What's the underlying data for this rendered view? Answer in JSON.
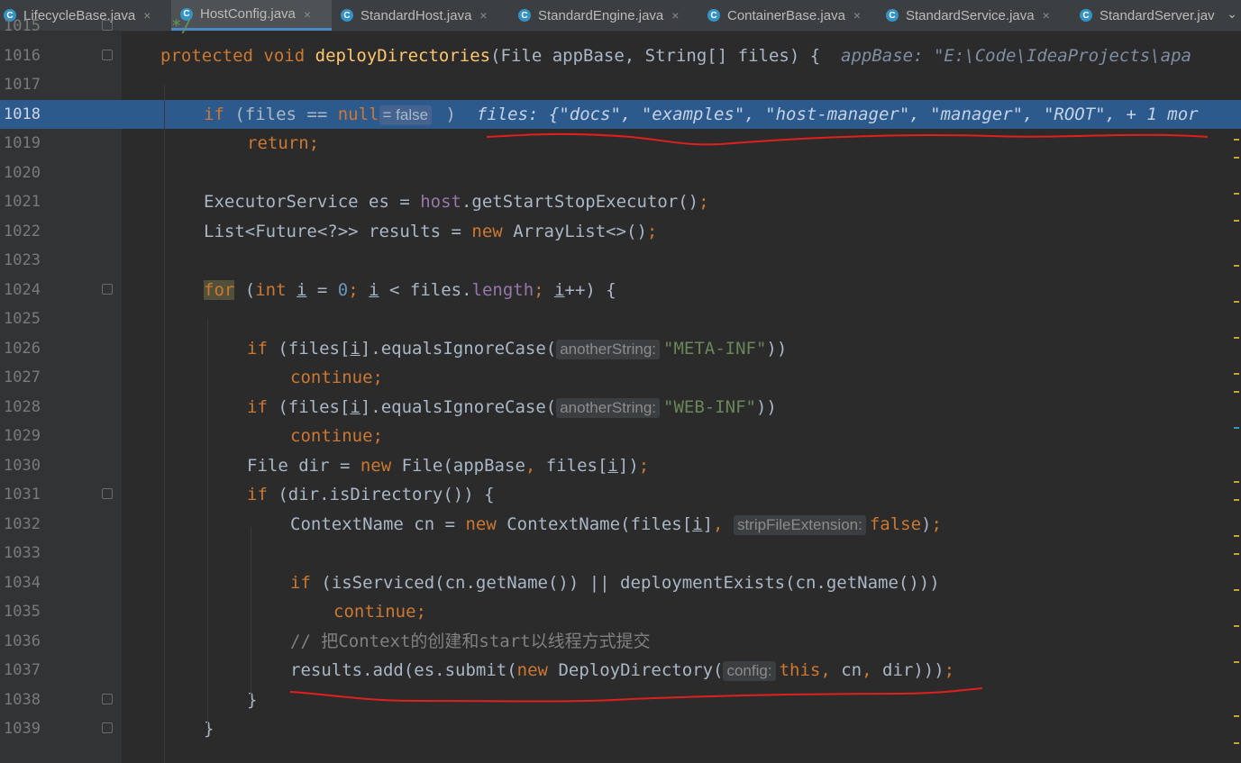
{
  "tabs": [
    {
      "label": "LifecycleBase.java",
      "active": false
    },
    {
      "label": "HostConfig.java",
      "active": true
    },
    {
      "label": "StandardHost.java",
      "active": false
    },
    {
      "label": "StandardEngine.java",
      "active": false
    },
    {
      "label": "ContainerBase.java",
      "active": false
    },
    {
      "label": "StandardService.java",
      "active": false
    },
    {
      "label": "StandardServer.jav",
      "active": false
    }
  ],
  "class_icon_letter": "C",
  "close_glyph": "×",
  "more_glyph": "⌄",
  "line_numbers": [
    "1015",
    "1016",
    "1017",
    "1018",
    "1019",
    "1020",
    "1021",
    "1022",
    "1023",
    "1024",
    "1025",
    "1026",
    "1027",
    "1028",
    "1029",
    "1030",
    "1031",
    "1032",
    "1033",
    "1034",
    "1035",
    "1036",
    "1037",
    "1038",
    "1039"
  ],
  "current_line": "1018",
  "code": {
    "l1015": "*/",
    "l1016_protected": "protected",
    "l1016_void": "void",
    "l1016_name": "deployDirectories",
    "l1016_params": "(File appBase, String[] files) {",
    "l1016_debug": "appBase: \"E:\\Code\\IdeaProjects\\apa",
    "l1018_if": "if",
    "l1018_cond": " (files == ",
    "l1018_null": "null",
    "l1018_hint": "= false",
    "l1018_close": " )",
    "l1018_debug": "files: {\"docs\", \"examples\", \"host-manager\", \"manager\", \"ROOT\", + 1 mor",
    "l1019": "return;",
    "l1021_a": "ExecutorService es = ",
    "l1021_host": "host",
    "l1021_b": ".getStartStopExecutor()",
    "l1021_semi": ";",
    "l1022_a": "List<Future<?>> results = ",
    "l1022_new": "new",
    "l1022_b": " ArrayList<>()",
    "l1022_semi": ";",
    "l1024_for": "for",
    "l1024_open": " (",
    "l1024_int": "int",
    "l1024_i1": "i",
    "l1024_eq": " = ",
    "l1024_zero": "0",
    "l1024_semi1": "; ",
    "l1024_i2": "i",
    "l1024_lt": " < files.",
    "l1024_length": "length",
    "l1024_semi2": "; ",
    "l1024_i3": "i",
    "l1024_end": "++) {",
    "l1026_if": "if",
    "l1026_a": " (files[",
    "l1026_i": "i",
    "l1026_b": "].equalsIgnoreCase(",
    "l1026_hint": "anotherString:",
    "l1026_str": "\"META-INF\"",
    "l1026_end": "))",
    "l1027": "continue;",
    "l1028_if": "if",
    "l1028_a": " (files[",
    "l1028_i": "i",
    "l1028_b": "].equalsIgnoreCase(",
    "l1028_hint": "anotherString:",
    "l1028_str": "\"WEB-INF\"",
    "l1028_end": "))",
    "l1029": "continue;",
    "l1030_a": "File dir = ",
    "l1030_new": "new",
    "l1030_b": " File(appBase",
    "l1030_comma": ", ",
    "l1030_c": "files[",
    "l1030_i": "i",
    "l1030_d": "])",
    "l1030_semi": ";",
    "l1031_if": "if",
    "l1031_a": " (dir.isDirectory()) {",
    "l1032_a": "ContextName cn = ",
    "l1032_new": "new",
    "l1032_b": " ContextName(files[",
    "l1032_i": "i",
    "l1032_c": "]",
    "l1032_comma": ", ",
    "l1032_hint": "stripFileExtension:",
    "l1032_false": "false",
    "l1032_end": ")",
    "l1032_semi": ";",
    "l1034_if": "if",
    "l1034_a": " (isServiced(cn.getName()) || deploymentExists(cn.getName()))",
    "l1035": "continue;",
    "l1036": "// 把Context的创建和start以线程方式提交",
    "l1037_a": "results.add(es.submit(",
    "l1037_new": "new",
    "l1037_b": " DeployDirectory(",
    "l1037_hint": "config:",
    "l1037_this": "this",
    "l1037_comma1": ", ",
    "l1037_cn": "cn",
    "l1037_comma2": ", ",
    "l1037_dir": "dir)))",
    "l1037_semi": ";",
    "l1038": "}",
    "l1039": "}"
  },
  "colors": {
    "background": "#2b2b2b",
    "gutter": "#313335",
    "current_line_highlight": "#2d5a8c",
    "keyword": "#cc7832",
    "method": "#ffc66d",
    "string": "#6a8759",
    "number": "#6897bb",
    "field": "#9876aa",
    "annotation_underline": "#e01f1f"
  }
}
